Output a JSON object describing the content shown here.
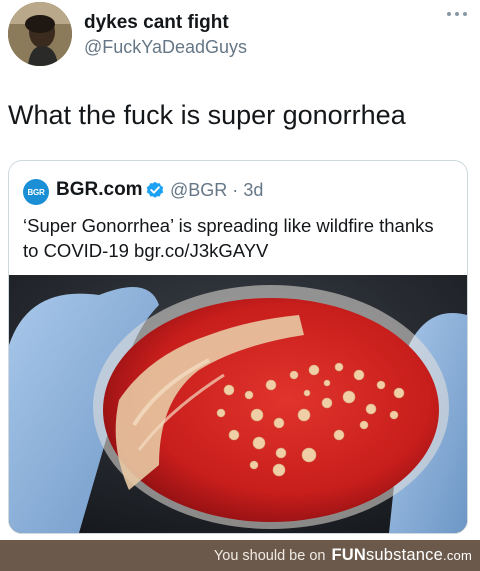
{
  "tweet": {
    "display_name": "dykes cant fight",
    "handle": "@FuckYaDeadGuys",
    "text": "What the fuck is super gonorrhea"
  },
  "quoted_tweet": {
    "logo_text": "BGR",
    "display_name": "BGR.com",
    "handle": "@BGR",
    "separator": "·",
    "time": "3d",
    "text": "‘Super Gonorrhea’ is spreading like wildfire thanks to COVID-19 bgr.co/J3kGAYV"
  },
  "footer": {
    "prefix": "You should be on",
    "brand_bold": "FUN",
    "brand_rest": "substance",
    "brand_tld": ".com"
  },
  "colors": {
    "verified": "#1da1f2",
    "bgr_logo": "#1a8fd6",
    "footer_bg": "#6b5a4b"
  }
}
